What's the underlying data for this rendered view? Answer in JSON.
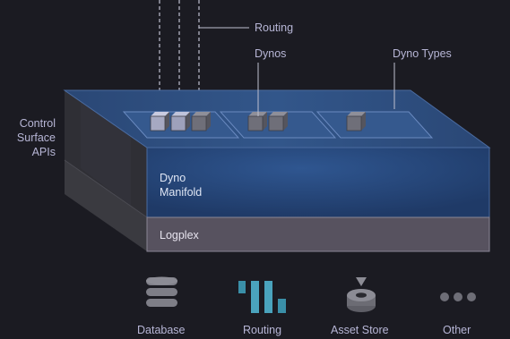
{
  "labels": {
    "routing_top": "Routing",
    "dynos": "Dynos",
    "dyno_types": "Dyno Types",
    "side": [
      "Control",
      "Surface",
      "APIs"
    ],
    "manifold": [
      "Dyno",
      "Manifold"
    ],
    "logplex": "Logplex"
  },
  "services": [
    {
      "label": "Database",
      "icon": "database-icon"
    },
    {
      "label": "Routing",
      "icon": "routing-bars-icon"
    },
    {
      "label": "Asset Store",
      "icon": "asset-store-icon"
    },
    {
      "label": "Other",
      "icon": "more-dots-icon"
    }
  ],
  "colors": {
    "background": "#1b1b22",
    "manifold_top": "#2c4a7a",
    "manifold_front": "#234273",
    "logplex_front": "#5a5562",
    "text": "#b7b6d6"
  }
}
